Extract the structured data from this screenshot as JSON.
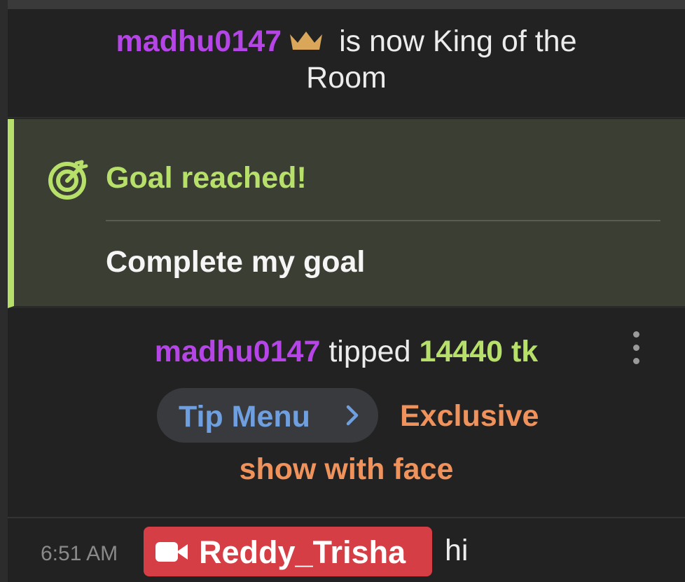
{
  "king_notice": {
    "username": "madhu0147",
    "icon": "crown-icon",
    "text_line1": "is now King of the",
    "text_line2": "Room"
  },
  "goal": {
    "icon": "target-icon",
    "title": "Goal reached!",
    "description": "Complete my goal"
  },
  "tip": {
    "username": "madhu0147",
    "verb": "tipped",
    "amount": "14440 tk",
    "more_icon": "more-vertical-icon",
    "menu_button_label": "Tip Menu",
    "menu_button_icon": "chevron-right-icon",
    "item_line1": "Exclusive",
    "item_line2": "show with face"
  },
  "message": {
    "time": "6:51 AM",
    "badge_icon": "camera-icon",
    "username": "Reddy_Trisha",
    "text": "hi"
  },
  "colors": {
    "background": "#222222",
    "username_purple": "#b545e6",
    "goal_green": "#b6e06a",
    "goal_bg": "#3b3e33",
    "tip_menu_blue": "#6f9fde",
    "tip_item_orange": "#ef925c",
    "badge_red": "#d63e45",
    "crown_gold": "#d9a65a"
  }
}
